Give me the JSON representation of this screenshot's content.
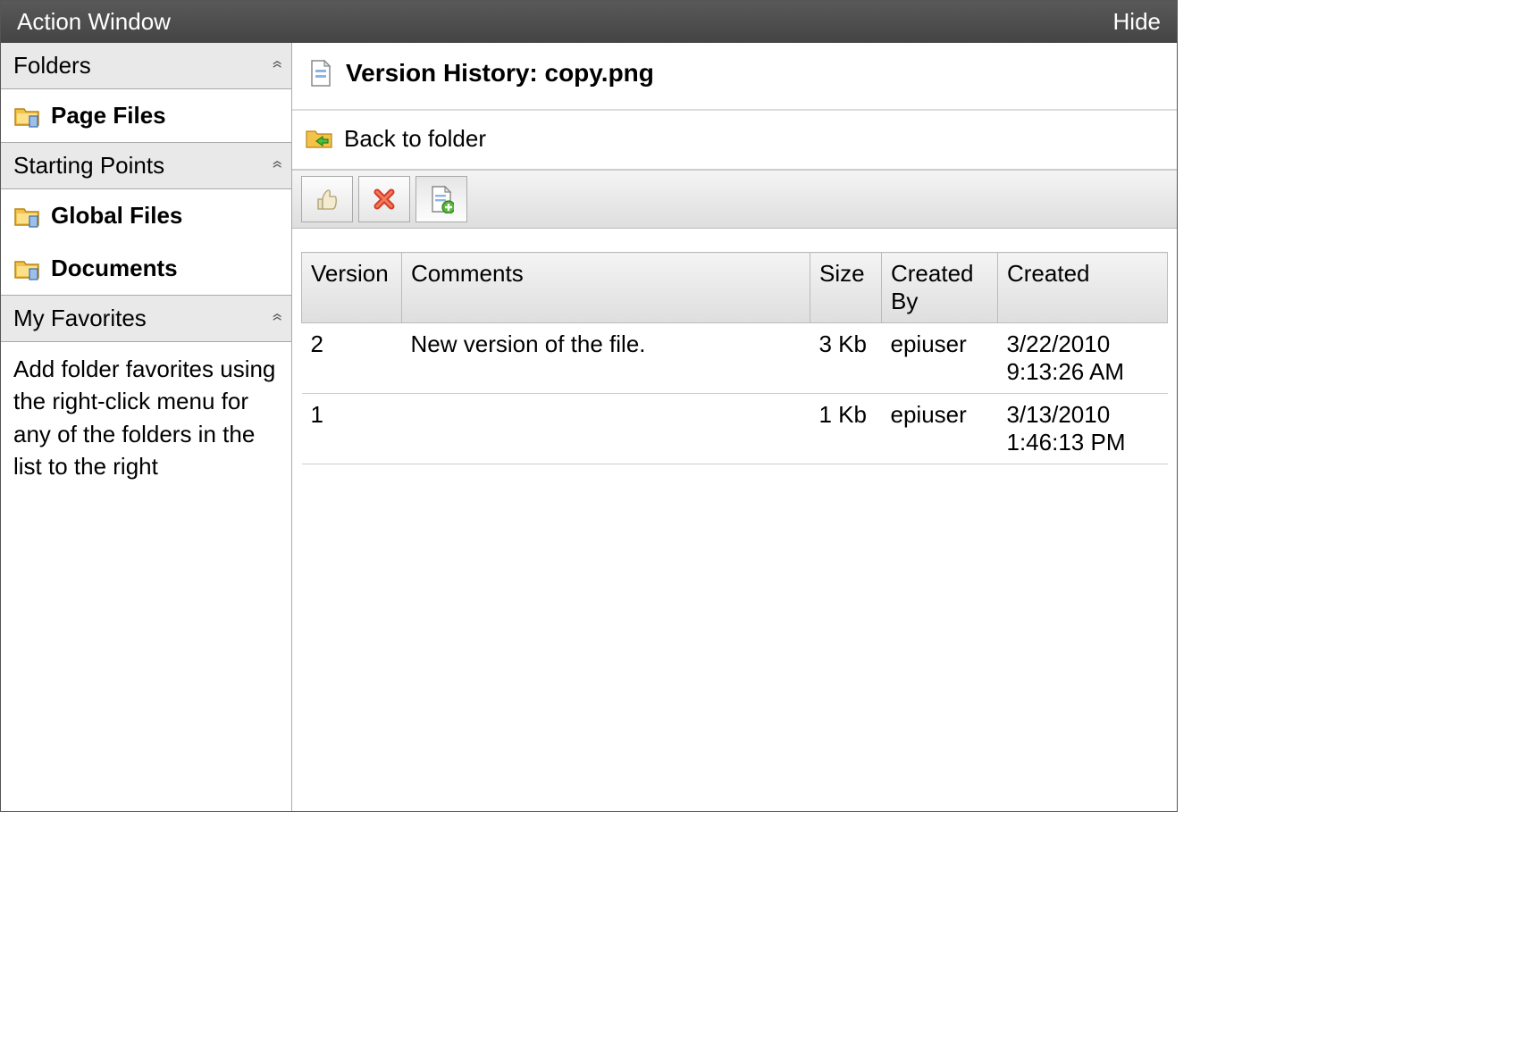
{
  "titlebar": {
    "title": "Action Window",
    "hide": "Hide"
  },
  "sidebar": {
    "folders": {
      "header": "Folders",
      "items": [
        {
          "label": "Page Files"
        }
      ]
    },
    "startingPoints": {
      "header": "Starting Points",
      "items": [
        {
          "label": "Global Files"
        },
        {
          "label": "Documents"
        }
      ]
    },
    "favorites": {
      "header": "My Favorites",
      "hint": "Add folder favorites using the right-click menu for any of the folders in the list to the right"
    }
  },
  "main": {
    "title": "Version History: copy.png",
    "back": "Back to folder",
    "columns": {
      "version": "Version",
      "comments": "Comments",
      "size": "Size",
      "createdBy": "Created By",
      "created": "Created"
    },
    "rows": [
      {
        "version": "2",
        "comments": "New version of the file.",
        "size": "3 Kb",
        "createdBy": "epiuser",
        "created": "3/22/2010 9:13:26 AM"
      },
      {
        "version": "1",
        "comments": "",
        "size": "1 Kb",
        "createdBy": "epiuser",
        "created": "3/13/2010 1:46:13 PM"
      }
    ]
  }
}
